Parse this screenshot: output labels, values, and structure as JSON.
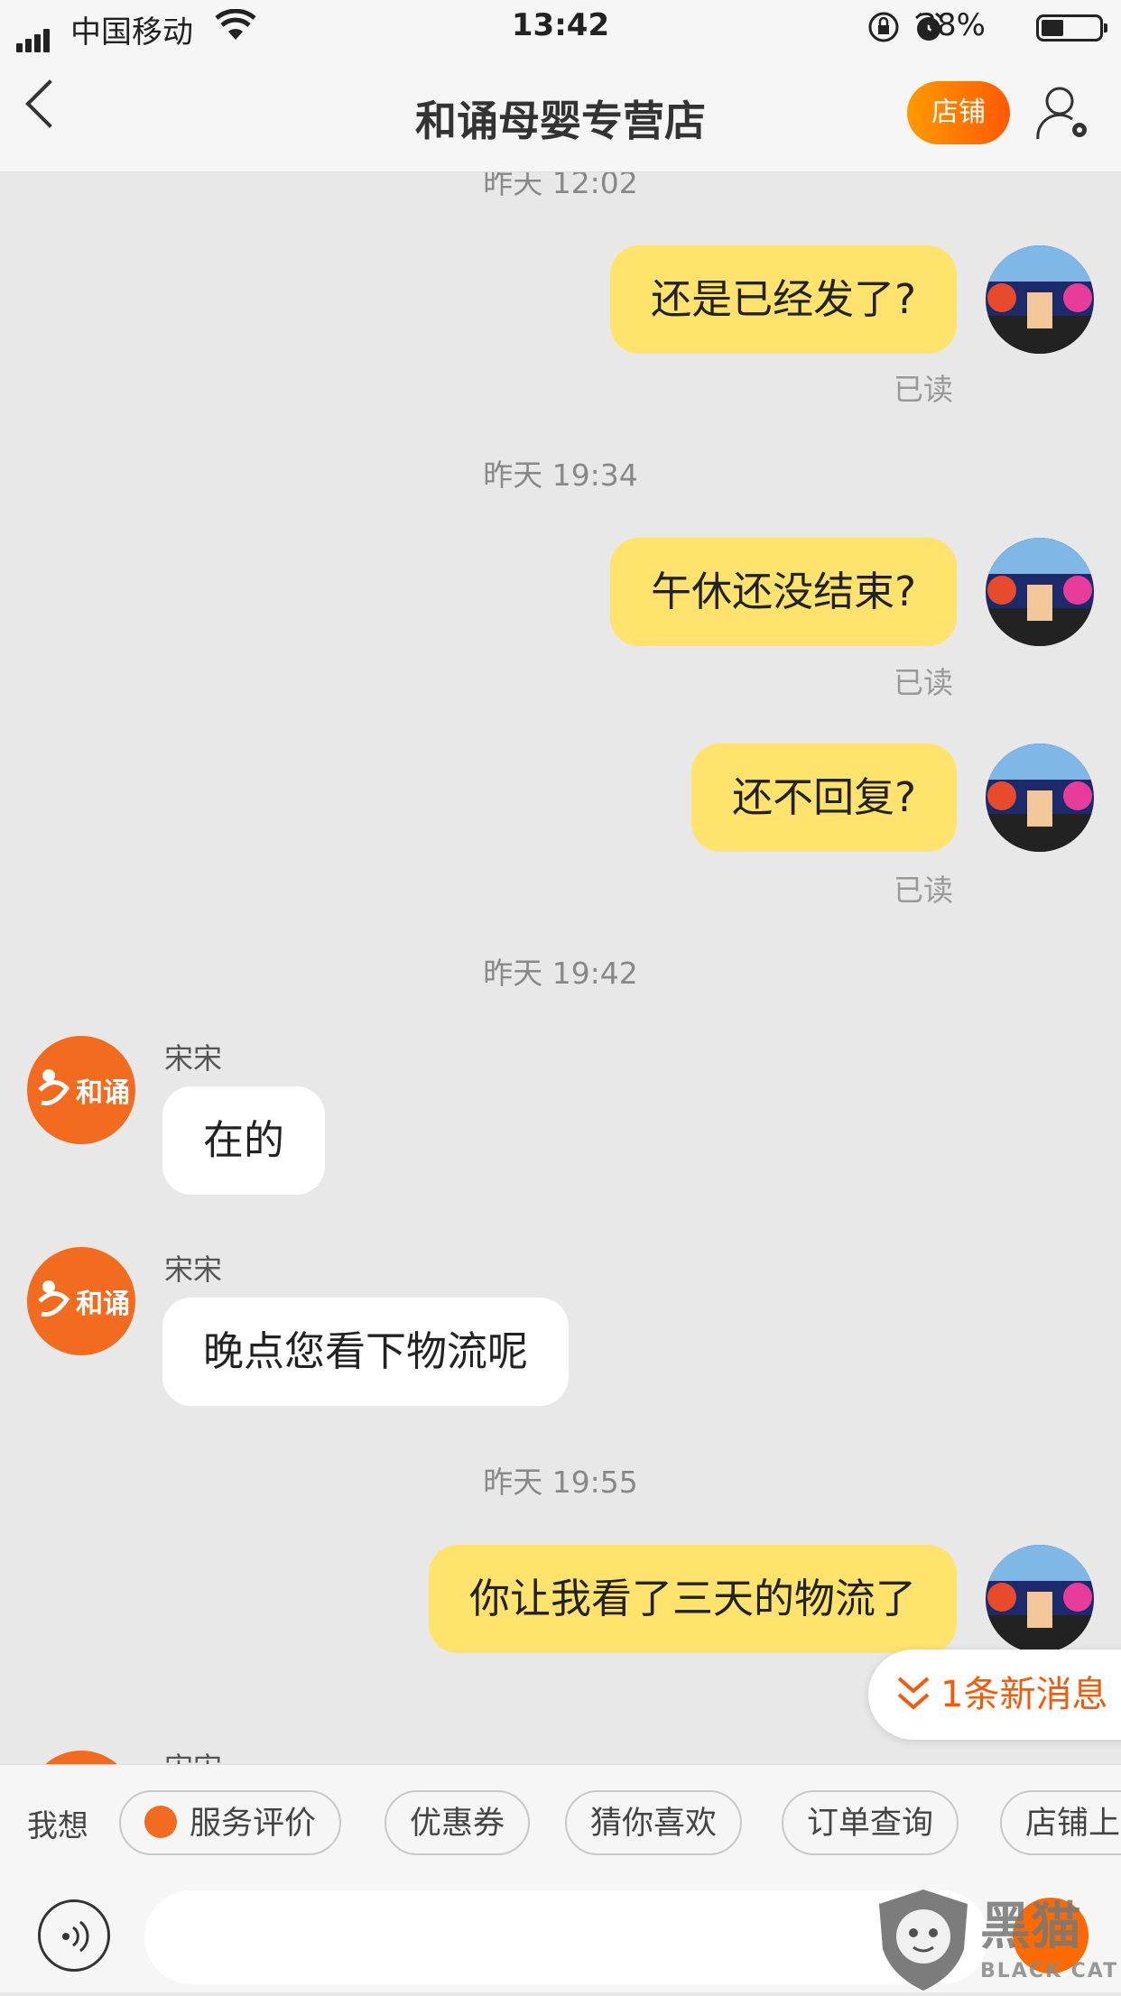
{
  "status_bar": {
    "carrier": "中国移动",
    "time": "13:42",
    "battery": "38%"
  },
  "header": {
    "title": "和诵母婴专营店",
    "shop_button": "店铺"
  },
  "messages": [
    {
      "timestamp": "昨天 12:02"
    },
    {
      "text": "还是已经发了?",
      "read": "已读"
    },
    {
      "timestamp": "昨天 19:34"
    },
    {
      "text": "午休还没结束?",
      "read": "已读"
    },
    {
      "text": "还不回复?",
      "read": "已读"
    },
    {
      "timestamp": "昨天 19:42"
    },
    {
      "sender": "宋宋",
      "text": "在的"
    },
    {
      "sender": "宋宋",
      "text": "晚点您看下物流呢"
    },
    {
      "timestamp": "昨天 19:55"
    },
    {
      "text": "你让我看了三天的物流了"
    },
    {
      "sender": "宋宋"
    }
  ],
  "shop_avatar_label": "和诵",
  "new_message": "1条新消息",
  "quick_bar": {
    "prefix": "我想",
    "chips": [
      "服务评价",
      "优惠券",
      "猜你喜欢",
      "订单查询",
      "店铺上新"
    ]
  },
  "watermark": {
    "cn": "黑猫",
    "en": "BLACK CAT"
  },
  "colors": {
    "accent": "#ff6a00",
    "my_bubble": "#ffe36c",
    "their_bubble": "#ffffff",
    "background": "#e8e8e8"
  }
}
